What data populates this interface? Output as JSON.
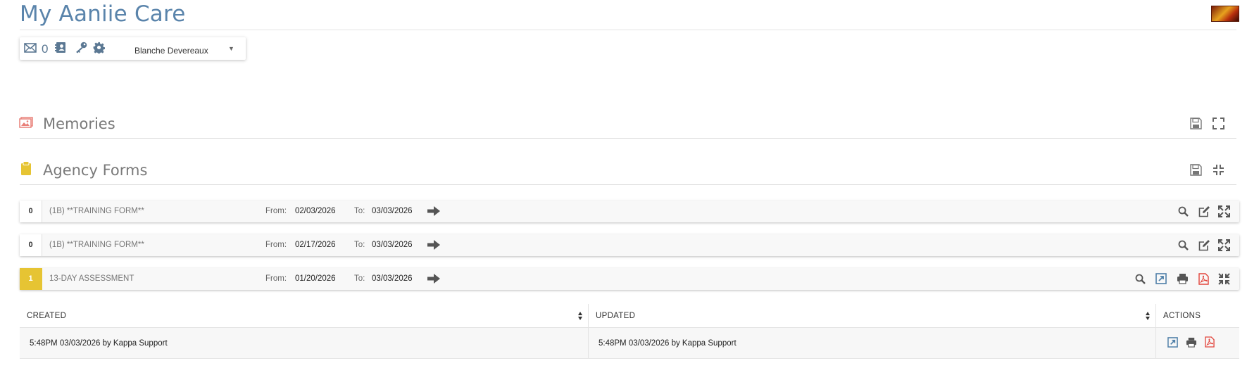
{
  "header": {
    "title": "My Aaniie Care"
  },
  "toolbar": {
    "mail_count": "0",
    "user_name": "Blanche Devereaux"
  },
  "sections": {
    "memories": {
      "title": "Memories"
    },
    "agency_forms": {
      "title": "Agency Forms"
    }
  },
  "forms": [
    {
      "count": "0",
      "name": "(1B) **TRAINING FORM**",
      "from_label": "From:",
      "from": "02/03/2026",
      "to_label": "To:",
      "to": "03/03/2026"
    },
    {
      "count": "0",
      "name": "(1B) **TRAINING FORM**",
      "from_label": "From:",
      "from": "02/17/2026",
      "to_label": "To:",
      "to": "03/03/2026"
    },
    {
      "count": "1",
      "name": "13-DAY ASSESSMENT",
      "from_label": "From:",
      "from": "01/20/2026",
      "to_label": "To:",
      "to": "03/03/2026"
    }
  ],
  "table": {
    "columns": [
      "CREATED",
      "UPDATED",
      "ACTIONS"
    ],
    "rows": [
      {
        "created": "5:48PM 03/03/2026 by Kappa Support",
        "updated": "5:48PM 03/03/2026 by Kappa Support"
      }
    ]
  },
  "colors": {
    "title": "#5a84ab",
    "icon": "#5b7893",
    "badge_active": "#e6c433",
    "pdf": "#e2453c",
    "memories_icon": "#e98079",
    "forms_icon": "#e6c433"
  },
  "icons": [
    "mail-icon",
    "contacts-icon",
    "key-icon",
    "gear-icon",
    "image-icon",
    "clipboard-icon",
    "save-icon",
    "expand-icon",
    "collapse-icon",
    "search-icon",
    "edit-icon",
    "arrow-right-icon",
    "open-external-icon",
    "print-icon",
    "pdf-icon",
    "sort-icon"
  ]
}
